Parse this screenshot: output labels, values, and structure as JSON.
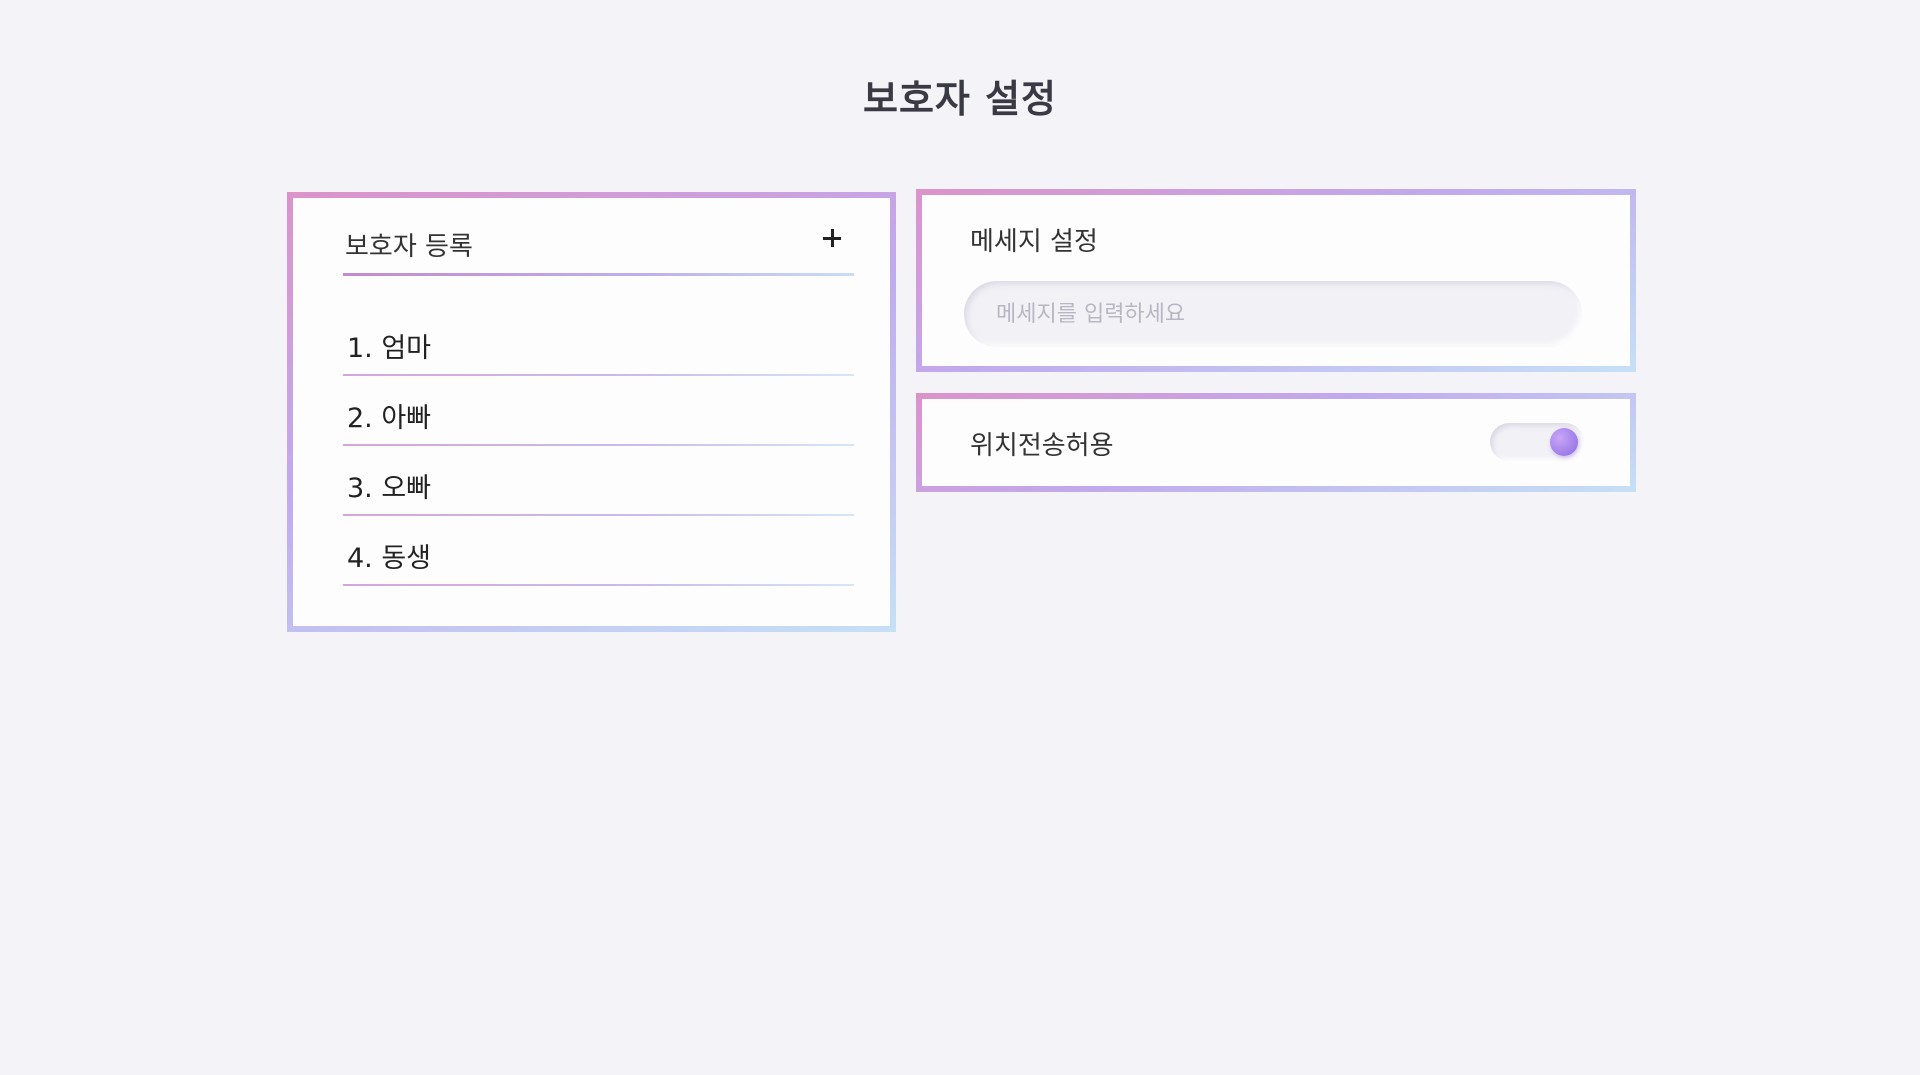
{
  "page": {
    "title": "보호자 설정"
  },
  "guardian": {
    "title": "보호자 등록",
    "add_icon": "plus-icon",
    "items": [
      {
        "label": "1. 엄마"
      },
      {
        "label": "2. 아빠"
      },
      {
        "label": "3. 오빠"
      },
      {
        "label": "4. 동생"
      }
    ]
  },
  "message": {
    "title": "메세지 설정",
    "placeholder": "메세지를 입력하세요",
    "value": ""
  },
  "location": {
    "label": "위치전송허용",
    "toggle_on": true
  },
  "colors": {
    "background": "#f4f3f8",
    "border_gradient_start": "#dc93c9",
    "border_gradient_mid": "#c0aaee",
    "border_gradient_end": "#c6e0f6",
    "toggle_knob": "#9d7ce8"
  }
}
